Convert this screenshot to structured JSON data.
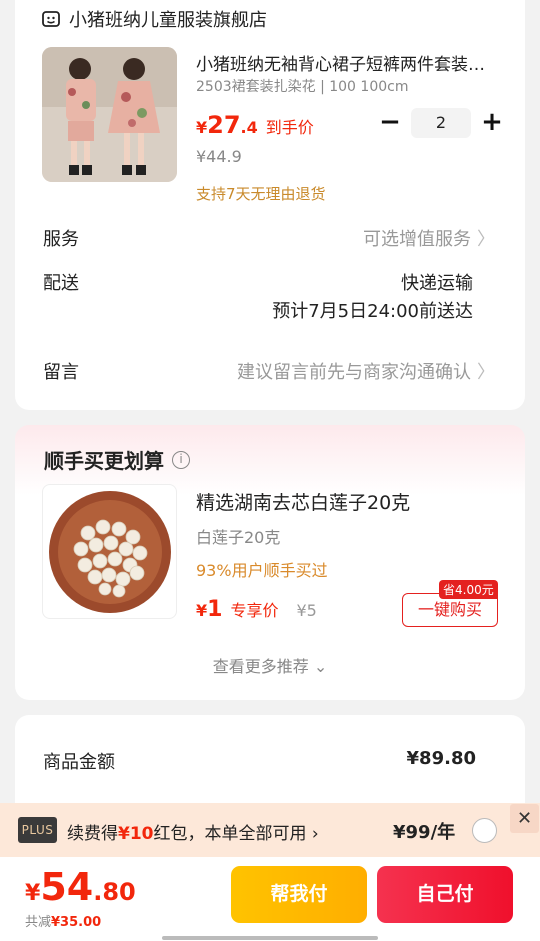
{
  "store": {
    "name": "小猪班纳儿童服装旗舰店",
    "icon": "store-icon"
  },
  "product": {
    "title": "小猪班纳无袖背心裙子短裤两件套装女童",
    "sku": "2503裙套装扎染花 | 100 100cm",
    "price_yen": "¥",
    "price_int": "27",
    "price_dec": ".4",
    "price_tag": "到手价",
    "original_price": "¥44.9",
    "return_policy": "支持7天无理由退货",
    "quantity": "2",
    "minus": "−",
    "plus": "+"
  },
  "service": {
    "label": "服务",
    "value": "可选增值服务",
    "chev": "〉"
  },
  "delivery": {
    "label": "配送",
    "method": "快递运输",
    "time": "预计7月5日24:00前送达"
  },
  "message": {
    "label": "留言",
    "placeholder": "建议留言前先与商家沟通确认",
    "chev": "〉"
  },
  "recommend": {
    "title": "顺手买更划算",
    "info": "i",
    "item": {
      "name": "精选湖南去芯白莲子20克",
      "sub": "白莲子20克",
      "bought": "93%用户顺手买过",
      "price_yen": "¥",
      "price": "1",
      "price_tag": "专享价",
      "old_price": "¥5",
      "save_badge": "省4.00元",
      "buy_label": "一键购买"
    },
    "see_more": "查看更多推荐 ⌄"
  },
  "summary": {
    "label": "商品金额",
    "value": "¥89.80"
  },
  "plus_bar": {
    "badge": "PLUS",
    "text_a": "续费得",
    "text_red": "¥10",
    "text_b": "红包，本单全部可用 ›",
    "price": "¥99/年",
    "close": "✕"
  },
  "checkout": {
    "yen": "¥",
    "total_int": "54",
    "total_dec": ".80",
    "discount_label": "共减",
    "discount_value": "¥35.00",
    "help_pay": "帮我付",
    "self_pay": "自己付"
  },
  "colors": {
    "accent": "#f2270c",
    "gold": "#ffc300",
    "plus_bg": "#fde8d9"
  }
}
